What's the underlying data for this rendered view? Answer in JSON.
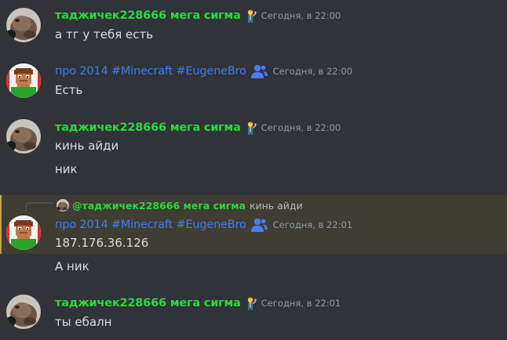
{
  "messages": [
    {
      "author": "таджичек228666 мега сигма",
      "author_color": "#2bd93c",
      "timestamp": "Сегодня, в 22:00",
      "badge": "vault-boy-icon",
      "lines": [
        "а тг у тебя есть"
      ]
    },
    {
      "author": "про 2014 #Minecraft #EugeneBro",
      "author_color": "#3d7cf5",
      "timestamp": "Сегодня, в 22:00",
      "badge": "people-icon",
      "lines": [
        "Есть"
      ]
    },
    {
      "author": "таджичек228666 мега сигма",
      "author_color": "#2bd93c",
      "timestamp": "Сегодня, в 22:00",
      "badge": "vault-boy-icon",
      "lines": [
        "кинь айди",
        "ник"
      ]
    },
    {
      "reply": {
        "author": "@таджичек228666 мега сигма",
        "text": "кинь айди"
      },
      "author": "про 2014 #Minecraft #EugeneBro",
      "author_color": "#3d7cf5",
      "timestamp": "Сегодня, в 22:01",
      "badge": "people-icon",
      "lines": [
        "187.176.36.126"
      ]
    },
    {
      "continuation": true,
      "lines": [
        "А ник"
      ]
    },
    {
      "author": "таджичек228666 мега сигма",
      "author_color": "#2bd93c",
      "timestamp": "Сегодня, в 22:01",
      "badge": "vault-boy-icon",
      "lines": [
        "ты ебалн"
      ]
    }
  ]
}
